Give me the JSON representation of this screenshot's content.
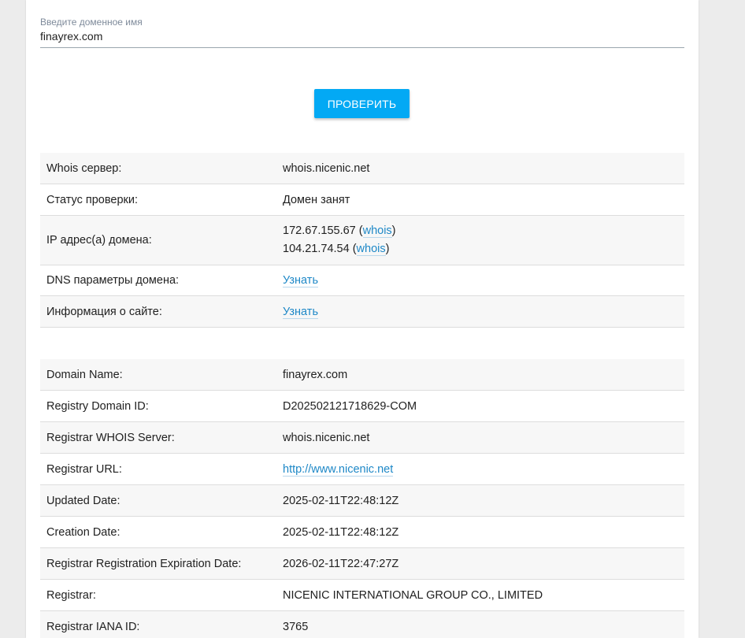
{
  "search": {
    "label": "Введите доменное имя",
    "value": "finayrex.com"
  },
  "check_button": "ПРОВЕРИТЬ",
  "summary": {
    "whois_server_label": "Whois сервер:",
    "whois_server_value": "whois.nicenic.net",
    "status_label": "Статус проверки:",
    "status_value": "Домен занят",
    "ip_label": "IP адрес(а) домена:",
    "ips": [
      {
        "ip": "172.67.155.67",
        "link": "whois"
      },
      {
        "ip": "104.21.74.54",
        "link": "whois"
      }
    ],
    "dns_label": "DNS параметры домена:",
    "dns_link": "Узнать",
    "site_label": "Информация о сайте:",
    "site_link": "Узнать"
  },
  "whois": [
    {
      "label": "Domain Name:",
      "value": "finayrex.com"
    },
    {
      "label": "Registry Domain ID:",
      "value": "D202502121718629-COM"
    },
    {
      "label": "Registrar WHOIS Server:",
      "value": "whois.nicenic.net"
    },
    {
      "label": "Registrar URL:",
      "value": "http://www.nicenic.net"
    },
    {
      "label": "Updated Date:",
      "value": "2025-02-11T22:48:12Z"
    },
    {
      "label": "Creation Date:",
      "value": "2025-02-11T22:48:12Z"
    },
    {
      "label": "Registrar Registration Expiration Date:",
      "value": "2026-02-11T22:47:27Z"
    },
    {
      "label": "Registrar:",
      "value": "NICENIC INTERNATIONAL GROUP CO., LIMITED"
    },
    {
      "label": "Registrar IANA ID:",
      "value": "3765"
    }
  ]
}
